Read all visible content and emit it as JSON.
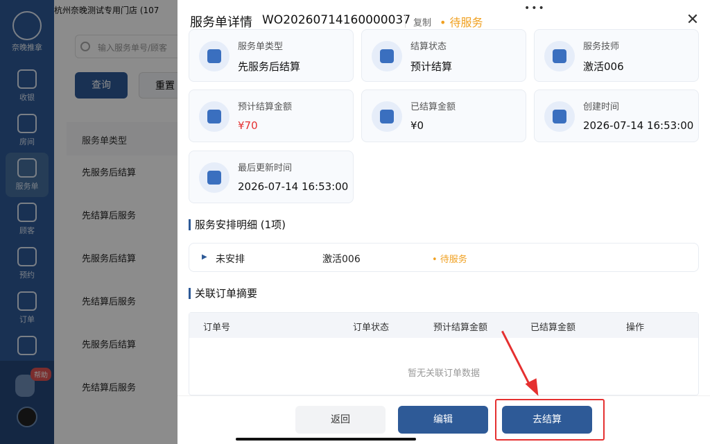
{
  "sidebar": {
    "logo_text": "奈晚推拿",
    "items": [
      {
        "label": "收银",
        "icon": "cashier-icon"
      },
      {
        "label": "房间",
        "icon": "home-icon"
      },
      {
        "label": "服务单",
        "icon": "service-order-icon"
      },
      {
        "label": "顾客",
        "icon": "user-icon"
      },
      {
        "label": "预约",
        "icon": "calendar-icon"
      },
      {
        "label": "订单",
        "icon": "order-icon"
      },
      {
        "label": "",
        "icon": "group-icon"
      }
    ],
    "help_badge": "帮助"
  },
  "background": {
    "store_name": "杭州奈晚测试专用门店 (107",
    "search_placeholder": "输入服务单号/顾客",
    "query_label": "查询",
    "reset_label": "重置",
    "column_header": "服务单类型",
    "rows": [
      "先服务后结算",
      "先结算后服务",
      "先服务后结算",
      "先结算后服务",
      "先服务后结算",
      "先结算后服务"
    ]
  },
  "modal": {
    "title": "服务单详情",
    "order_no": "WO20260714160000037",
    "copy_label": "复制",
    "status": "• 待服务",
    "cards": [
      {
        "label": "服务单类型",
        "value": "先服务后结算",
        "icon": "document-icon"
      },
      {
        "label": "结算状态",
        "value": "预计结算",
        "icon": "yen-card-icon"
      },
      {
        "label": "服务技师",
        "value": "激活006",
        "icon": "technician-icon"
      },
      {
        "label": "预计结算金额",
        "value": "¥70",
        "icon": "estimate-icon"
      },
      {
        "label": "已结算金额",
        "value": "¥0",
        "icon": "settled-icon"
      },
      {
        "label": "创建时间",
        "value": "2026-07-14 16:53:00",
        "icon": "clock-icon"
      },
      {
        "label": "最后更新时间",
        "value": "2026-07-14 16:53:00",
        "icon": "refresh-icon"
      }
    ],
    "schedule_title": "服务安排明细 (1项)",
    "schedule_row": {
      "state": "未安排",
      "tech": "激活006",
      "status": "• 待服务"
    },
    "related_title": "关联订单摘要",
    "table_headers": [
      "订单号",
      "订单状态",
      "预计结算金额",
      "已结算金额",
      "操作"
    ],
    "empty_text": "暂无关联订单数据",
    "buttons": {
      "back": "返回",
      "edit": "编辑",
      "settle": "去结算"
    }
  },
  "colors": {
    "primary": "#2e5a97",
    "warning": "#f0a020",
    "price": "#e53030"
  }
}
